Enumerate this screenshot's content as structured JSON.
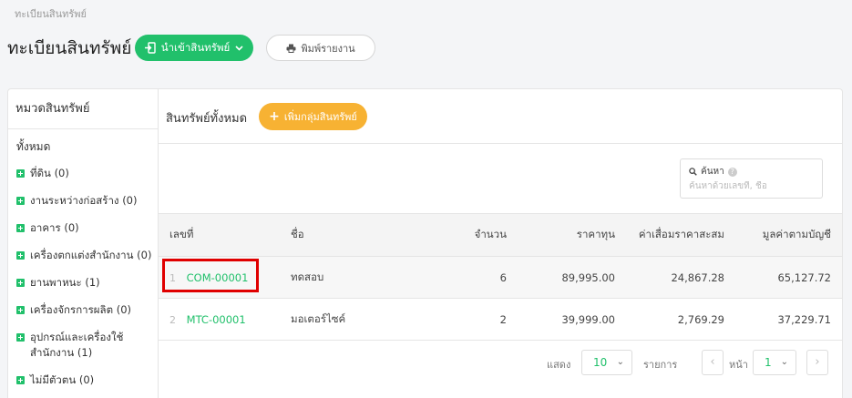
{
  "breadcrumb": "ทะเบียนสินทรัพย์",
  "page_title": "ทะเบียนสินทรัพย์",
  "toolbar": {
    "import_label": "นำเข้าสินทรัพย์",
    "print_label": "พิมพ์รายงาน"
  },
  "colors": {
    "accent_green": "#21c06b",
    "accent_orange": "#f7b233",
    "highlight_red": "#e00000"
  },
  "sidebar": {
    "title": "หมวดสินทรัพย์",
    "all_label": "ทั้งหมด",
    "items": [
      {
        "label": "ที่ดิน (0)"
      },
      {
        "label": "งานระหว่างก่อสร้าง (0)"
      },
      {
        "label": "อาคาร (0)"
      },
      {
        "label": "เครื่องตกแต่งสำนักงาน (0)"
      },
      {
        "label": "ยานพาหนะ (1)"
      },
      {
        "label": "เครื่องจักรการผลิต (0)"
      },
      {
        "label": "อุปกรณ์และเครื่องใช้สำนักงาน (1)"
      },
      {
        "label": "ไม่มีตัวตน (0)"
      }
    ]
  },
  "main": {
    "title": "สินทรัพย์ทั้งหมด",
    "add_group_label": "เพิ่มกลุ่มสินทรัพย์",
    "search": {
      "label": "ค้นหา",
      "placeholder": "ค้นหาด้วยเลขที่, ชื่อ"
    },
    "table": {
      "columns": [
        "เลขที่",
        "ชื่อ",
        "จำนวน",
        "ราคาทุน",
        "ค่าเสื่อมราคาสะสม",
        "มูลค่าตามบัญชี"
      ],
      "rows": [
        {
          "index": "1",
          "code": "COM-00001",
          "name": "ทดสอบ",
          "qty": "6",
          "cost": "89,995.00",
          "depreciation": "24,867.28",
          "book_value": "65,127.72"
        },
        {
          "index": "2",
          "code": "MTC-00001",
          "name": "มอเตอร์ไซค์",
          "qty": "2",
          "cost": "39,999.00",
          "depreciation": "2,769.29",
          "book_value": "37,229.71"
        }
      ]
    },
    "pager": {
      "show_label": "แสดง",
      "page_size": "10",
      "items_label": "รายการ",
      "page_label": "หน้า",
      "page": "1"
    }
  }
}
